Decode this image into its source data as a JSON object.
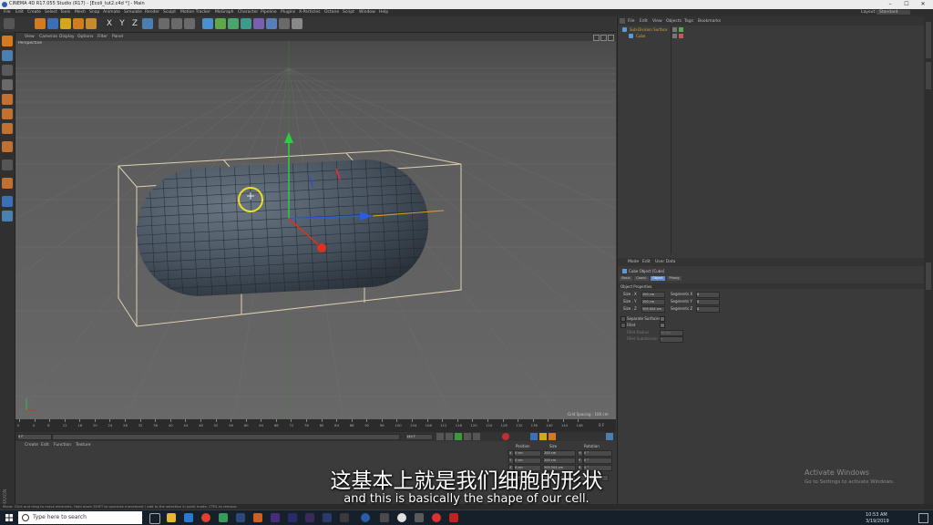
{
  "window": {
    "title": "CINEMA 4D R17.055 Studio (R17) - [Ecoli_tut2.c4d *] - Main",
    "controls": [
      "–",
      "☐",
      "✕"
    ]
  },
  "menubar": {
    "items": [
      "File",
      "Edit",
      "Create",
      "Select",
      "Tools",
      "Mesh",
      "Snap",
      "Animate",
      "Simulate",
      "Render",
      "Sculpt",
      "Motion Tracker",
      "MoGraph",
      "Character",
      "Pipeline",
      "Plugins",
      "X-Particles",
      "Octane",
      "Script",
      "Window",
      "Help"
    ],
    "layout_label": "Layout:",
    "layout_value": "Standard"
  },
  "viewport": {
    "menu": [
      "View",
      "Cameras",
      "Display",
      "Options",
      "Filter",
      "Panel"
    ],
    "label": "Perspective",
    "grid_spacing": "Grid Spacing : 100 cm"
  },
  "timeline": {
    "ticks": [
      "0",
      "4",
      "8",
      "12",
      "16",
      "20",
      "24",
      "28",
      "32",
      "36",
      "40",
      "44",
      "48",
      "52",
      "56",
      "60",
      "64",
      "68",
      "72",
      "76",
      "80",
      "84",
      "88",
      "92",
      "96",
      "100",
      "104",
      "108",
      "112",
      "116",
      "120",
      "124",
      "128",
      "132",
      "136",
      "140",
      "144",
      "148"
    ],
    "end_label": "0 F",
    "current_frame": "0 F",
    "start_field": "0 F",
    "end_field": "144 F"
  },
  "material_panel": {
    "menu": [
      "Create",
      "Edit",
      "Function",
      "Texture"
    ]
  },
  "coords": {
    "headers": [
      "Position",
      "Size",
      "Rotation"
    ],
    "rows": [
      {
        "axis": "X",
        "pos": "0 cm",
        "size": "200 cm",
        "rot_axis": "H",
        "rot": "0 °"
      },
      {
        "axis": "Y",
        "pos": "0 cm",
        "size": "200 cm",
        "rot_axis": "P",
        "rot": "0 °"
      },
      {
        "axis": "Z",
        "pos": "0 cm",
        "size": "505.504 cm",
        "rot_axis": "B",
        "rot": "0 °"
      }
    ],
    "mode": "Object (Rel)",
    "size_mode": "Size",
    "apply": "Apply"
  },
  "object_manager": {
    "menu": [
      "File",
      "Edit",
      "View",
      "Objects",
      "Tags",
      "Bookmarks"
    ],
    "objects": [
      {
        "name": "Sub-Division Surface"
      },
      {
        "name": "Cube"
      }
    ]
  },
  "attribute_manager": {
    "menu": [
      "Mode",
      "Edit",
      "User Data"
    ],
    "object_title": "Cube Object [Cube]",
    "tabs": [
      "Basic",
      "Coord.",
      "Object",
      "Phong"
    ],
    "active_tab": "Object",
    "section": "Object Properties",
    "size_rows": [
      {
        "label": "Size . X",
        "value": "200 cm",
        "seg_label": "Segments X",
        "seg": "8"
      },
      {
        "label": "Size . Y",
        "value": "200 cm",
        "seg_label": "Segments Y",
        "seg": "8"
      },
      {
        "label": "Size . Z",
        "value": "505.504 cm",
        "seg_label": "Segments Z",
        "seg": "8"
      }
    ],
    "checks": [
      {
        "label": "Separate Surfaces"
      },
      {
        "label": "Fillet"
      }
    ],
    "fillet_rows": [
      {
        "label": "Fillet Radius",
        "value": "40 cm"
      },
      {
        "label": "Fillet Subdivision",
        "value": "5"
      }
    ]
  },
  "statusbar": {
    "text": "Move: Click and drag to move elements. Hold down SHIFT to quantize movement / add to the selection in point mode, CTRL to remove."
  },
  "subtitles": {
    "chinese": "这基本上就是我们细胞的形状",
    "english": "and this is basically the shape of our cell."
  },
  "watermark": {
    "line1": "Activate Windows",
    "line2": "Go to Settings to activate Windows."
  },
  "branding": {
    "maxon": "MAXON",
    "product": "CINEMA 4D"
  },
  "taskbar": {
    "search_placeholder": "Type here to search",
    "time": "10:53 AM",
    "date": "3/19/2019"
  }
}
